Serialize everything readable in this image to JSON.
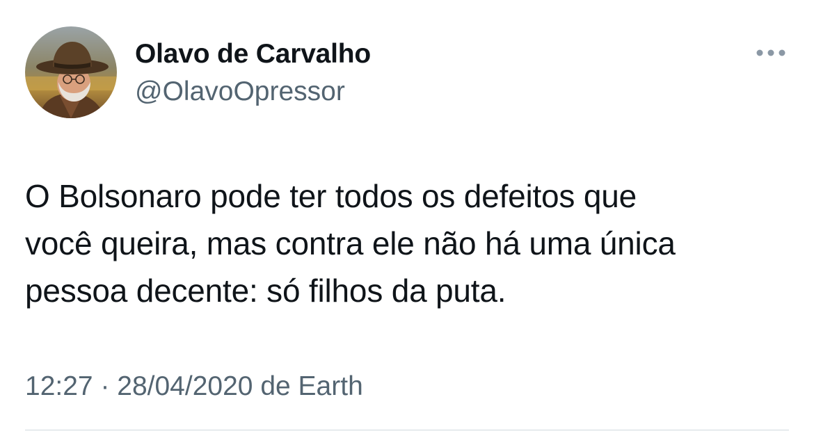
{
  "author": {
    "display_name": "Olavo de Carvalho",
    "handle": "@OlavoOpressor",
    "avatar_icon": "profile-photo"
  },
  "tweet": {
    "text": "O Bolsonaro pode ter todos os defeitos que\nvocê queira, mas contra ele não há uma única\npessoa decente: só filhos da puta.",
    "time": "12:27",
    "separator": " · ",
    "date": "28/04/2020",
    "source_prefix": " de ",
    "source": "Earth"
  },
  "menu": {
    "icon": "more-horizontal-icon"
  },
  "colors": {
    "text": "#0f1419",
    "secondary": "#536471",
    "divider": "#cfd9de",
    "background": "#ffffff"
  }
}
